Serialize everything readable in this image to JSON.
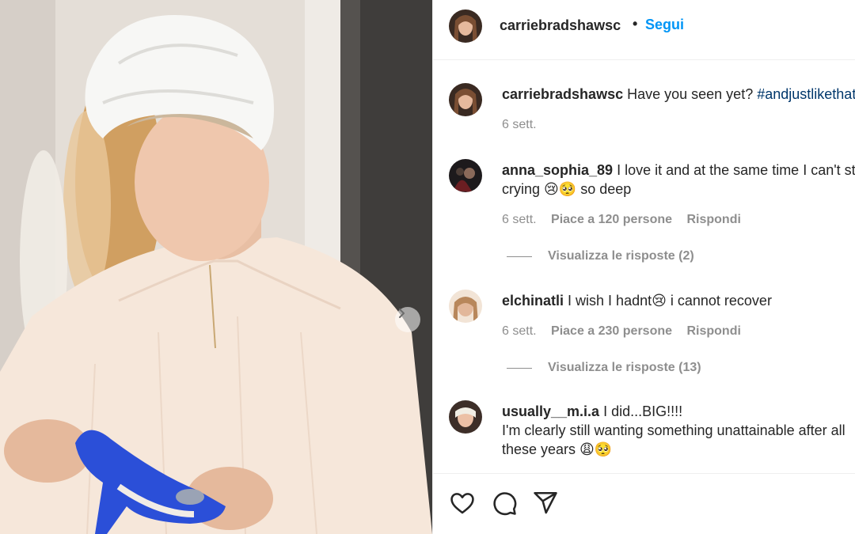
{
  "post": {
    "author": "carriebradshawsc",
    "separator": "•",
    "follow_label": "Segui",
    "caption_text": "Have you seen yet?",
    "caption_hashtag": "#andjustlikethat",
    "caption_time": "6 sett."
  },
  "comments": [
    {
      "username": "anna_sophia_89",
      "text_line1": "I love it and at the same time I can't stop",
      "text_line2": "crying 😢🥺 so deep",
      "time": "6 sett.",
      "likes": "Piace a 120 persone",
      "reply_label": "Rispondi",
      "view_replies": "Visualizza le risposte (2)"
    },
    {
      "username": "elchinatli",
      "text_line1": "I wish I hadnt😢 i cannot recover",
      "time": "6 sett.",
      "likes": "Piace a 230 persone",
      "reply_label": "Rispondi",
      "view_replies": "Visualizza le risposte (13)"
    },
    {
      "username": "usually__m.i.a",
      "text_line1": "I did...BIG!!!!",
      "text_line2": "I'm clearly still wanting something unattainable after all",
      "text_line3": "these years 😩🥺"
    }
  ],
  "actions": [
    "heart-icon",
    "comment-icon",
    "share-icon"
  ],
  "colors": {
    "link_blue": "#0095f6",
    "hashtag": "#00376b",
    "meta_gray": "#8e8e8e",
    "text": "#262626"
  }
}
